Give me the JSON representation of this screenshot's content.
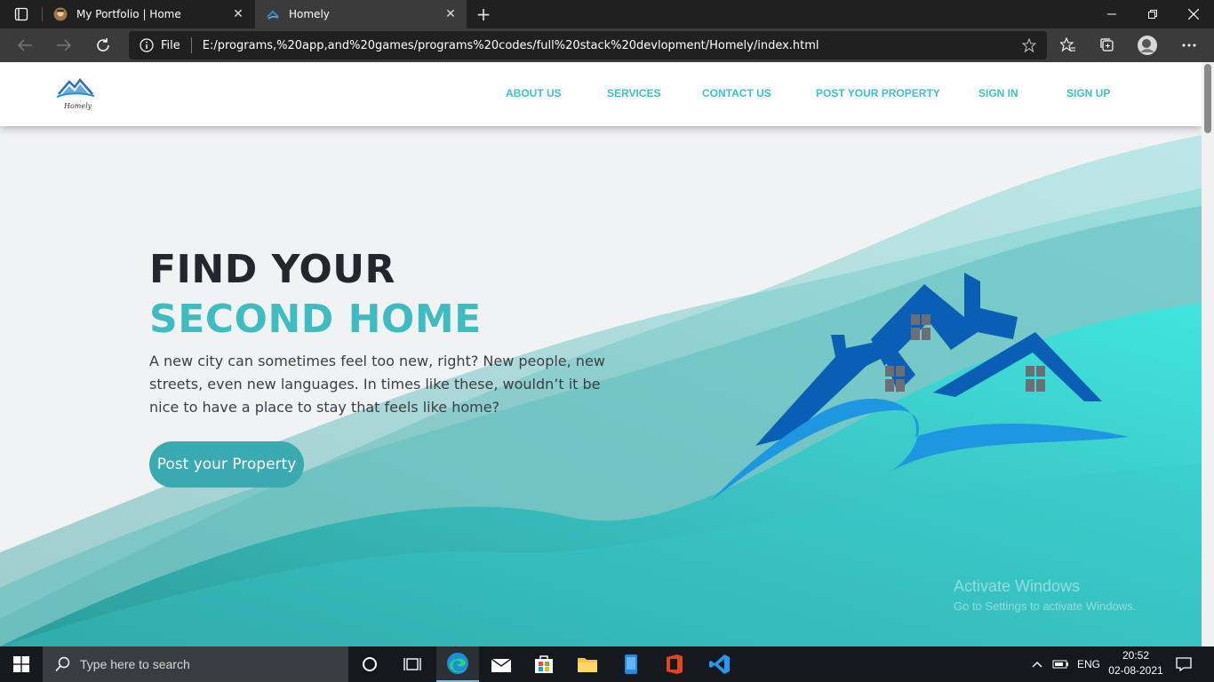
{
  "browser": {
    "tabs": [
      {
        "title": "My Portfolio | Home",
        "active": false
      },
      {
        "title": "Homely",
        "active": true
      }
    ],
    "address": {
      "scheme_label": "File",
      "url": "E:/programs,%20app,and%20games/programs%20codes/full%20stack%20devlopment/Homely/index.html"
    }
  },
  "site": {
    "logo_text": "Homely",
    "nav": [
      "ABOUT US",
      "SERVICES",
      "CONTACT US",
      "POST YOUR PROPERTY",
      "SIGN IN",
      "SIGN UP"
    ],
    "hero": {
      "title_line1": "FIND YOUR",
      "title_line2": "SECOND HOME",
      "paragraph": "A new city can sometimes feel too new, right? New people, new streets, even new languages. In times like these, wouldn’t it be nice to have a place to stay that feels like home?",
      "cta": "Post your Property"
    },
    "colors": {
      "accent": "#3ec1c9",
      "wave": "#37d6d6",
      "house_blue": "#0a5fb4",
      "house_light": "#1e96e0"
    }
  },
  "watermark": {
    "line1": "Activate Windows",
    "line2": "Go to Settings to activate Windows."
  },
  "taskbar": {
    "search_placeholder": "Type here to search",
    "lang": "ENG",
    "time": "20:52",
    "date": "02-08-2021"
  }
}
